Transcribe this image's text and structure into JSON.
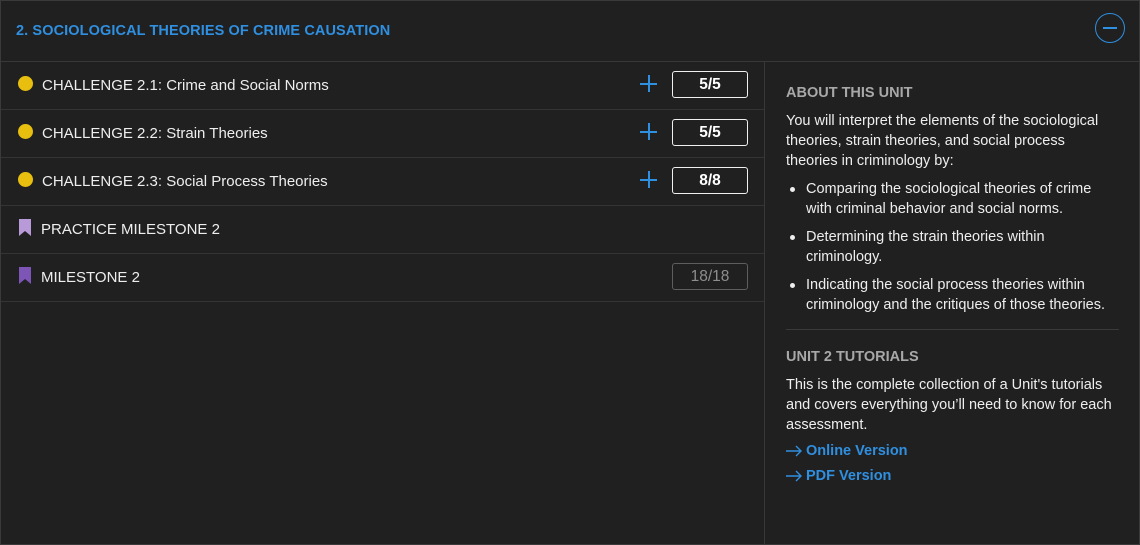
{
  "unit": {
    "title": "2. SOCIOLOGICAL THEORIES OF CRIME CAUSATION",
    "collapse_icon": "minus-circle-icon"
  },
  "items": [
    {
      "label": "CHALLENGE 2.1: Crime and Social Norms",
      "score": "5/5",
      "icon": "yellow-dot-icon",
      "has_plus": true
    },
    {
      "label": "CHALLENGE 2.2: Strain Theories",
      "score": "5/5",
      "icon": "yellow-dot-icon",
      "has_plus": true
    },
    {
      "label": "CHALLENGE 2.3: Social Process Theories",
      "score": "8/8",
      "icon": "yellow-dot-icon",
      "has_plus": true
    },
    {
      "label": "PRACTICE MILESTONE 2",
      "score": "",
      "icon": "bookmark-icon",
      "has_plus": false
    },
    {
      "label": "MILESTONE 2",
      "score": "18/18",
      "icon": "bookmark-icon",
      "has_plus": false
    }
  ],
  "about": {
    "heading": "ABOUT THIS UNIT",
    "intro": "You will interpret the elements of the sociological theories, strain theories, and social process theories in criminology by:",
    "bullets": [
      "Comparing the sociological theories of crime with criminal behavior and social norms.",
      "Determining the strain theories within criminology.",
      "Indicating the social process theories within criminology and the critiques of those theories."
    ]
  },
  "tutorials": {
    "heading": "UNIT 2 TUTORIALS",
    "description": "This is the complete collection of a Unit's tutorials and covers everything you’ll need to know for each assessment.",
    "links": [
      "Online Version",
      "PDF Version"
    ]
  },
  "colors": {
    "accent": "#2f8fe0",
    "dot": "#e8bf0e",
    "bookmark_light": "#b89ad8",
    "bookmark_dark": "#7d55b6"
  }
}
